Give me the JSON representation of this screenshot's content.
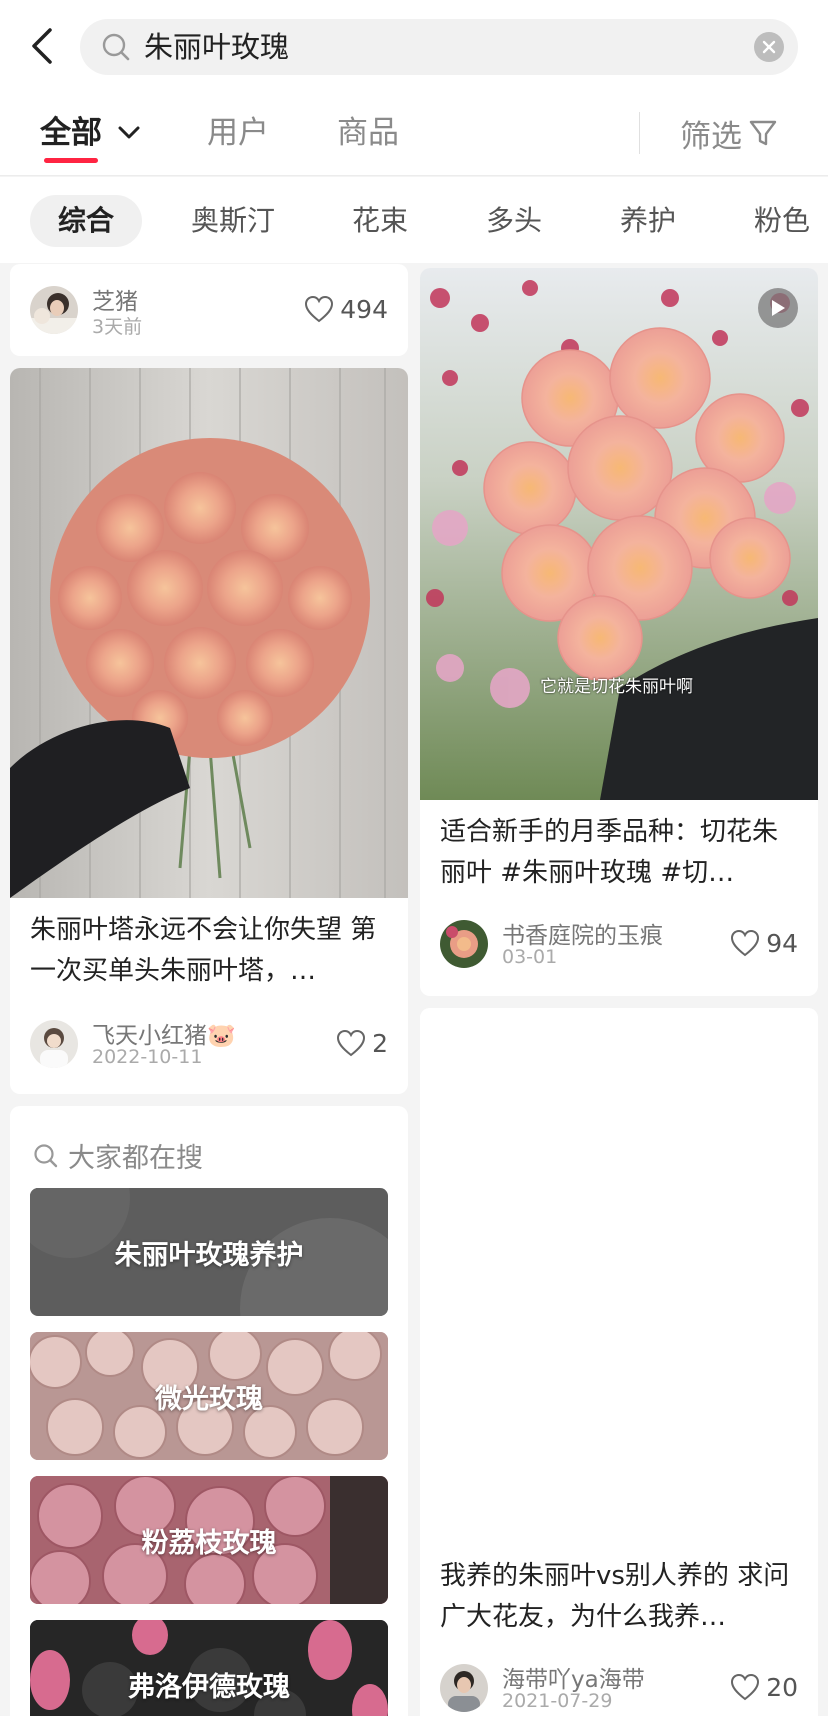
{
  "search": {
    "query": "朱丽叶玫瑰"
  },
  "tabs": [
    {
      "label": "全部"
    },
    {
      "label": "用户"
    },
    {
      "label": "商品"
    }
  ],
  "filter": {
    "label": "筛选"
  },
  "chips": [
    "综合",
    "奥斯汀",
    "花束",
    "多头",
    "养护",
    "粉色"
  ],
  "feed": {
    "top_left": {
      "author": "芝猪",
      "time": "3天前",
      "likes": "494"
    },
    "bouquet": {
      "title": "朱丽叶塔永远不会让你失望 第一次买单头朱丽叶塔，…",
      "author": "飞天小红猪🐷",
      "time": "2022-10-11",
      "likes": "2"
    },
    "video": {
      "caption": "它就是切花朱丽叶啊",
      "title": "适合新手的月季品种：切花朱丽叶 #朱丽叶玫瑰 #切…",
      "author": "书香庭院的玉痕",
      "time": "03-01",
      "likes": "94"
    },
    "bottom_right": {
      "title": "我养的朱丽叶vs别人养的 求问广大花友，为什么我养…",
      "author": "海带吖ya海带",
      "time": "2021-07-29",
      "likes": "20"
    }
  },
  "trending": {
    "header": "大家都在搜",
    "items": [
      {
        "label": "朱丽叶玫瑰养护"
      },
      {
        "label": "微光玫瑰"
      },
      {
        "label": "粉荔枝玫瑰"
      },
      {
        "label": "弗洛伊德玫瑰"
      }
    ]
  },
  "colors": {
    "accent": "#ff2442",
    "background": "#f4f4f4",
    "card": "#ffffff"
  }
}
